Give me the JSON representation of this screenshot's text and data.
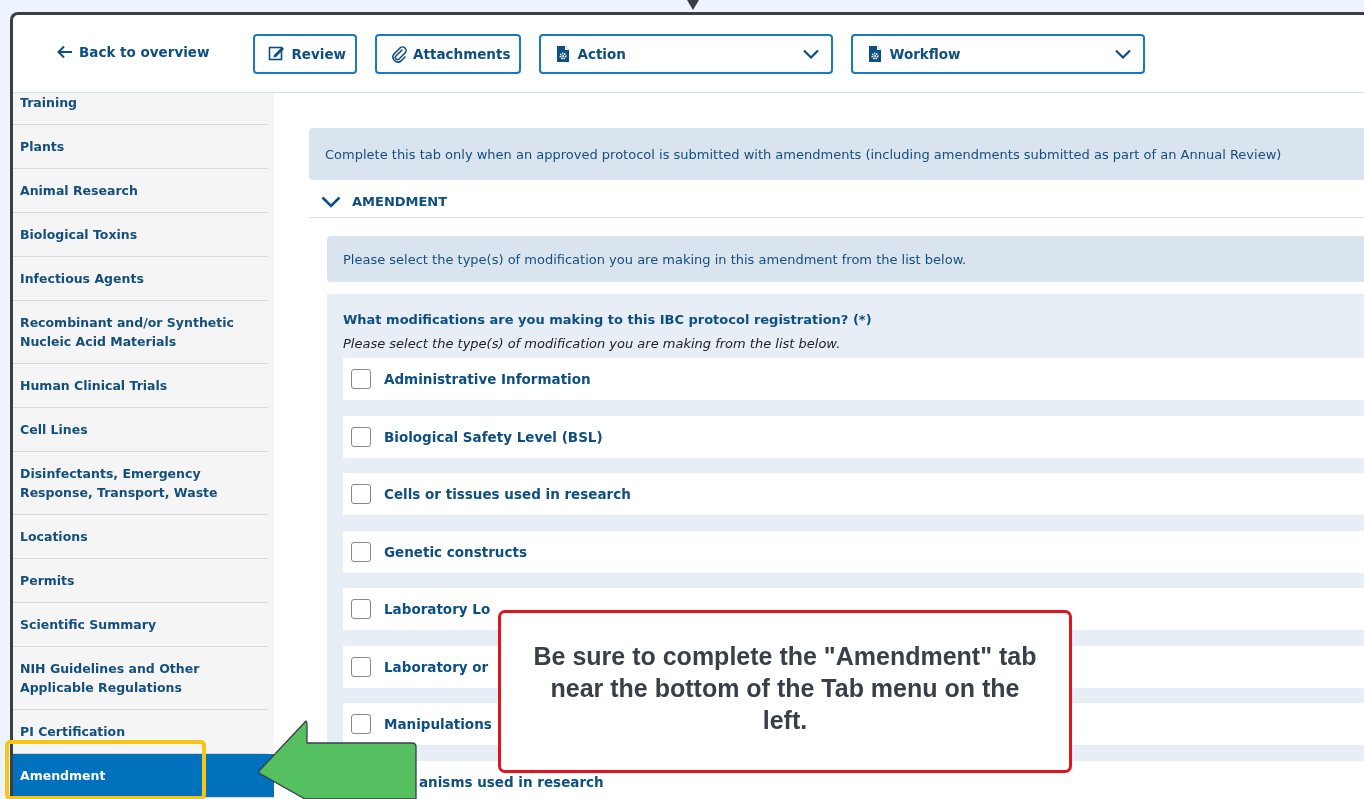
{
  "header": {
    "back_link": "Back to overview",
    "buttons": [
      {
        "kind": "button",
        "label": "Review"
      },
      {
        "kind": "button",
        "label": "Attachments"
      },
      {
        "kind": "dropdown",
        "label": "Action"
      },
      {
        "kind": "dropdown",
        "label": "Workflow"
      }
    ]
  },
  "sidebar": {
    "items": [
      {
        "label": "Training",
        "selected": false
      },
      {
        "label": "Plants",
        "selected": false
      },
      {
        "label": "Animal Research",
        "selected": false
      },
      {
        "label": "Biological Toxins",
        "selected": false
      },
      {
        "label": "Infectious Agents",
        "selected": false
      },
      {
        "label": "Recombinant and/or Synthetic Nucleic Acid Materials",
        "selected": false
      },
      {
        "label": "Human Clinical Trials",
        "selected": false
      },
      {
        "label": "Cell Lines",
        "selected": false
      },
      {
        "label": "Disinfectants, Emergency Response, Transport, Waste",
        "selected": false
      },
      {
        "label": "Locations",
        "selected": false
      },
      {
        "label": "Permits",
        "selected": false
      },
      {
        "label": "Scientific Summary",
        "selected": false
      },
      {
        "label": "NIH Guidelines and Other Applicable Regulations",
        "selected": false
      },
      {
        "label": "PI Certification",
        "selected": false
      },
      {
        "label": "Amendment",
        "selected": true
      }
    ]
  },
  "content": {
    "notice": "Complete this tab only when an approved protocol is submitted with amendments (including amendments submitted as part of an Annual Review)",
    "section": {
      "title": "AMENDMENT",
      "expanded": true
    },
    "instruction": "Please select the type(s) of modification you are making in this amendment from the list below.",
    "question": {
      "label": "What modifications are you making to this IBC protocol registration? (*)",
      "hint": "Please select the type(s) of modification you are making from the list below.",
      "options": [
        {
          "kind": "full",
          "label": "Administrative Information",
          "checked": false
        },
        {
          "kind": "full",
          "label": "Biological Safety Level (BSL)",
          "checked": false
        },
        {
          "kind": "full",
          "label": "Cells or tissues used in research",
          "checked": false
        },
        {
          "kind": "full",
          "label": "Genetic constructs",
          "checked": false
        },
        {
          "kind": "full",
          "label": "Laboratory Lo",
          "checked": false
        },
        {
          "kind": "full",
          "label": "Laboratory or",
          "checked": false
        },
        {
          "kind": "full",
          "label": "Manipulations",
          "checked": false
        },
        {
          "kind": "partial",
          "label": "anisms used in research"
        }
      ]
    }
  },
  "callout": {
    "text": "Be sure to complete the \"Amendment\" tab near the bottom of the Tab menu on the left."
  }
}
